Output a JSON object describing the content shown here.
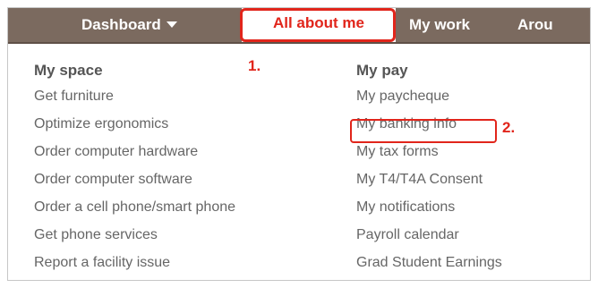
{
  "navbar": {
    "items": [
      {
        "label": "Dashboard",
        "has_caret": true
      },
      {
        "label": "All about me",
        "active": true
      },
      {
        "label": "My work"
      },
      {
        "label": "Arou"
      }
    ]
  },
  "annotations": {
    "step1": "1.",
    "step2": "2."
  },
  "menu": {
    "my_space": {
      "heading": "My space",
      "links": [
        "Get furniture",
        "Optimize ergonomics",
        "Order computer hardware",
        "Order computer software",
        "Order a cell phone/smart phone",
        "Get phone services",
        "Report a facility issue"
      ]
    },
    "my_pay": {
      "heading": "My pay",
      "links": [
        "My paycheque",
        "My banking info",
        "My tax forms",
        "My T4/T4A Consent",
        "My notifications",
        "Payroll calendar",
        "Grad Student Earnings"
      ]
    }
  },
  "colors": {
    "navbar_bg": "#7b6a5f",
    "highlight_red": "#e1251b",
    "link_gray": "#666666",
    "heading_gray": "#555555"
  }
}
